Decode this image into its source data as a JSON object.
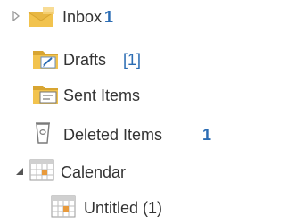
{
  "folders": [
    {
      "label": "Inbox",
      "count": "1",
      "count_style": "bold",
      "icon": "inbox-icon",
      "expander": "collapsed"
    },
    {
      "label": "Drafts",
      "count": "[1]",
      "count_style": "bracket",
      "icon": "drafts-icon",
      "expander": "none"
    },
    {
      "label": "Sent Items",
      "count": "",
      "count_style": "none",
      "icon": "sent-items-icon",
      "expander": "none"
    },
    {
      "label": "Deleted Items",
      "count": "1",
      "count_style": "bold",
      "icon": "trash-icon",
      "expander": "none"
    },
    {
      "label": "Calendar",
      "count": "",
      "count_style": "none",
      "icon": "calendar-icon",
      "expander": "expanded"
    },
    {
      "label": "Untitled (1)",
      "count": "",
      "count_style": "none",
      "icon": "calendar-icon",
      "expander": "none"
    }
  ],
  "colors": {
    "folder_yellow": "#f2c34e",
    "folder_dark": "#d8a531",
    "count_blue": "#2b6cb3",
    "text": "#333333",
    "calendar_orange": "#e89a3c"
  }
}
